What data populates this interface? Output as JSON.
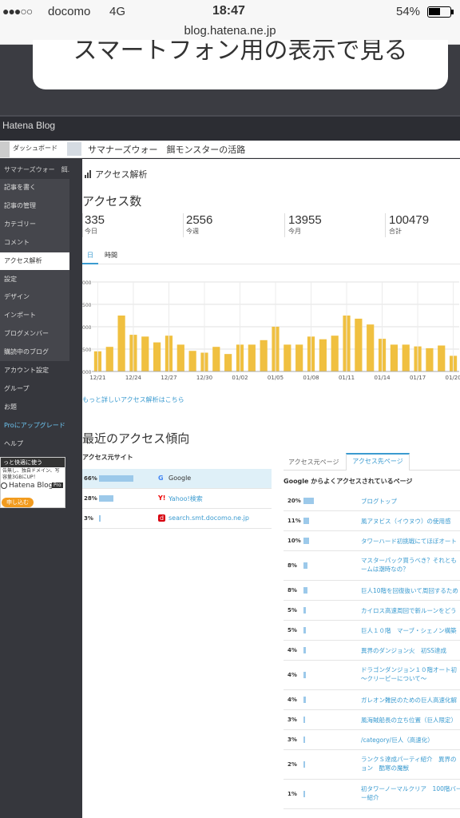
{
  "status_bar": {
    "signal": "●●●○○",
    "carrier": "docomo",
    "network": "4G",
    "time": "18:47",
    "battery": "54%"
  },
  "browser": {
    "url": "blog.hatena.ne.jp"
  },
  "banner": {
    "text": "スマートフォン用の表示で見る"
  },
  "app": {
    "logo": "Hatena Blog"
  },
  "top_nav": {
    "dashboard": "ダッシュボード",
    "blog_title": "サマナーズウォー　餌モンスターの活路"
  },
  "sidebar": {
    "blog_name": "サマナーズウォー　餌...",
    "items": [
      "記事を書く",
      "記事の管理",
      "カテゴリー",
      "コメント",
      "アクセス解析",
      "設定",
      "デザイン",
      "インポート",
      "ブログメンバー",
      "購読中のブログ",
      "アカウント設定",
      "グループ",
      "お題",
      "Proにアップグレード",
      "ヘルプ"
    ],
    "active_index": 4,
    "pro_box": {
      "title": "っと快適に使う",
      "desc": "告無し、独自ドメイン、写\n容量3GBにUP！",
      "logo": "Hatena Blog",
      "badge": "Pro",
      "button": "申し込む"
    }
  },
  "page": {
    "section_title": "アクセス解析",
    "heading": "アクセス数"
  },
  "kpis": [
    {
      "value": "335",
      "label": "今日"
    },
    {
      "value": "2556",
      "label": "今週"
    },
    {
      "value": "13955",
      "label": "今月"
    },
    {
      "value": "100479",
      "label": "合計"
    }
  ],
  "chart_tabs": [
    "日",
    "時間"
  ],
  "chart_data": {
    "type": "bar",
    "categories": [
      "12/21",
      "12/22",
      "12/23",
      "12/24",
      "12/25",
      "12/26",
      "12/27",
      "12/28",
      "12/29",
      "12/30",
      "12/31",
      "01/01",
      "01/02",
      "01/03",
      "01/04",
      "01/05",
      "01/06",
      "01/07",
      "01/08",
      "01/09",
      "01/10",
      "01/11",
      "01/12",
      "01/13",
      "01/14",
      "01/15",
      "01/16",
      "01/17",
      "01/18",
      "01/19",
      "01/20"
    ],
    "tick_labels": [
      "12/21",
      "12/24",
      "12/27",
      "12/30",
      "01/02",
      "01/05",
      "01/08",
      "01/11",
      "01/14",
      "01/17",
      "01/20"
    ],
    "values": [
      450,
      550,
      1250,
      820,
      780,
      650,
      800,
      600,
      460,
      420,
      550,
      390,
      600,
      600,
      700,
      1000,
      600,
      600,
      780,
      720,
      800,
      1250,
      1180,
      1050,
      730,
      600,
      600,
      560,
      520,
      580,
      350
    ],
    "y_tick_labels": [
      "000",
      "500",
      "000",
      "500",
      "000"
    ],
    "ylim": [
      0,
      2000
    ],
    "color": "#f0c040"
  },
  "more_link": "もっと詳しいアクセス解析はこちら",
  "recent": {
    "heading": "最近のアクセス傾向",
    "sources_title": "アクセス元サイト",
    "sources": [
      {
        "pct": "66%",
        "frac": 0.66,
        "icon": "google-icon",
        "name": "Google",
        "highlight": true
      },
      {
        "pct": "28%",
        "frac": 0.28,
        "icon": "yahoo-icon",
        "name": "Yahoo!検索",
        "highlight": false
      },
      {
        "pct": "3%",
        "frac": 0.03,
        "icon": "docomo-icon",
        "name": "search.smt.docomo.ne.jp",
        "highlight": false
      }
    ],
    "tabs": [
      "アクセス元ページ",
      "アクセス先ページ"
    ],
    "active_tab": 1,
    "pages_title": "Google からよくアクセスされているページ",
    "pages": [
      {
        "pct": "20%",
        "frac": 0.2,
        "title": "ブログトップ"
      },
      {
        "pct": "11%",
        "frac": 0.11,
        "title": "風アヌビス（イウヌウ）の使用感"
      },
      {
        "pct": "10%",
        "frac": 0.1,
        "title": "タワーハード初挑戦にてほぼオート"
      },
      {
        "pct": "8%",
        "frac": 0.08,
        "title": "マスターパック買うべき？それとも\nームは潮時なの？"
      },
      {
        "pct": "8%",
        "frac": 0.08,
        "title": "巨人10階を回復抜いて周回するため"
      },
      {
        "pct": "5%",
        "frac": 0.05,
        "title": "カイロス高速周回で新ルーンをどう"
      },
      {
        "pct": "5%",
        "frac": 0.05,
        "title": "巨人１０階　マーブ・シェノン構築"
      },
      {
        "pct": "4%",
        "frac": 0.04,
        "title": "異界のダンジョン火　初SS達成"
      },
      {
        "pct": "4%",
        "frac": 0.04,
        "title": "ドラゴンダンジョン１０階オート初\n〜クリーピーについて〜"
      },
      {
        "pct": "4%",
        "frac": 0.04,
        "title": "ガレオン難民のための巨人高速化解"
      },
      {
        "pct": "3%",
        "frac": 0.03,
        "title": "風海賊船長の立ち位置（巨人限定）"
      },
      {
        "pct": "3%",
        "frac": 0.03,
        "title": "/category/巨人（高速化）"
      },
      {
        "pct": "2%",
        "frac": 0.02,
        "title": "ランクＳ達成パーティ紹介　異界の\nョン　酷寒の魔獣"
      },
      {
        "pct": "1%",
        "frac": 0.01,
        "title": "初タワーノーマルクリア　100階バー\nー紹介"
      }
    ]
  }
}
